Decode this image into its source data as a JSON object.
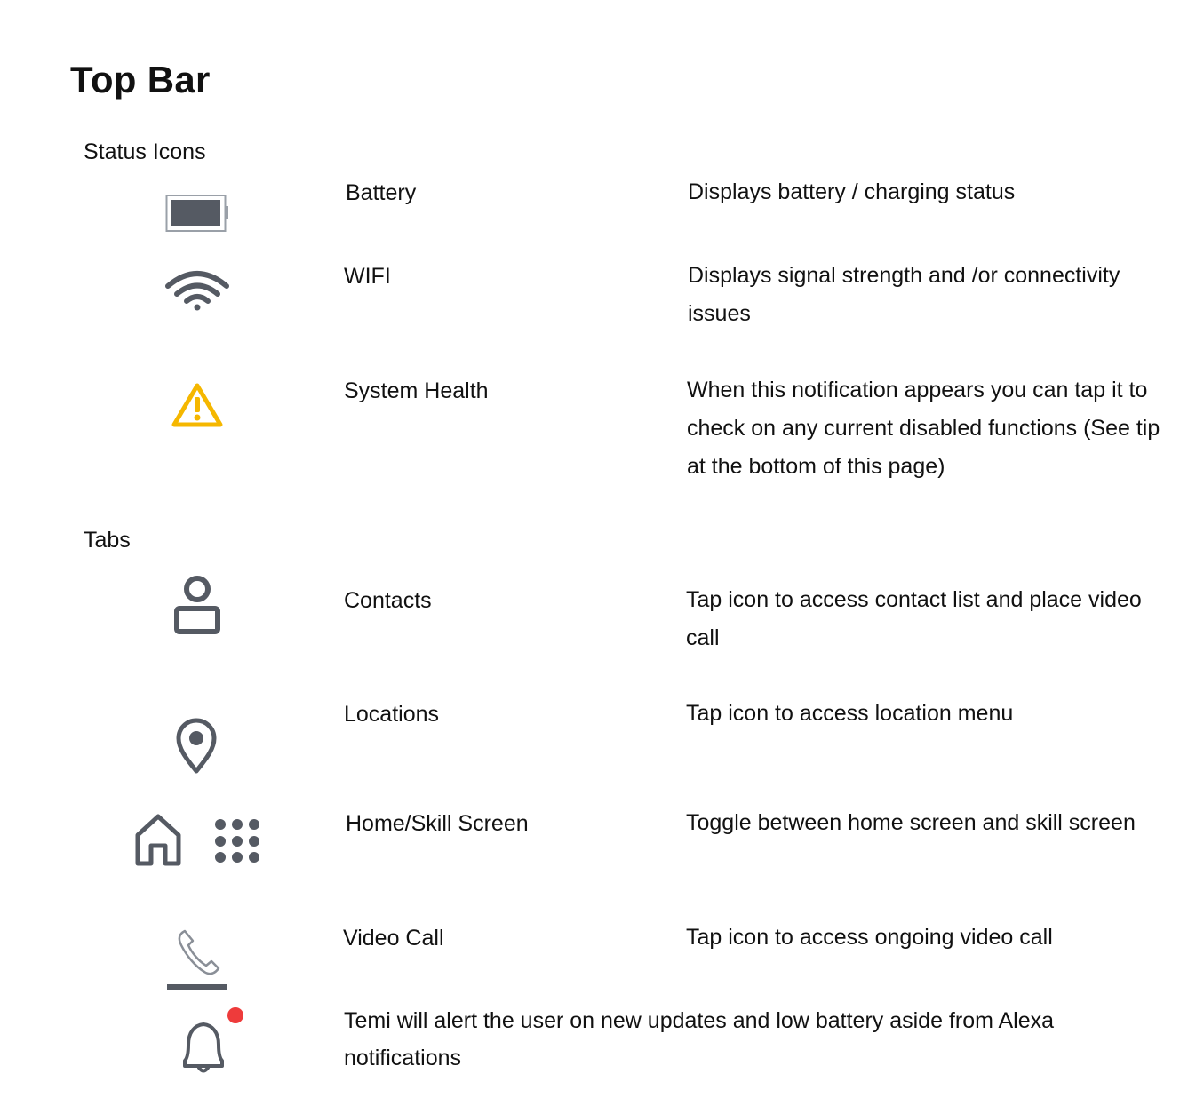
{
  "title": "Top Bar",
  "sections": {
    "status_icons": "Status Icons",
    "tabs": "Tabs"
  },
  "status_items": [
    {
      "icon": "battery-icon",
      "name": "Battery",
      "description": "Displays battery / charging status"
    },
    {
      "icon": "wifi-icon",
      "name": "WIFI",
      "description": "Displays signal strength and /or connectivity issues"
    },
    {
      "icon": "warning-icon",
      "name": "System Health",
      "description": "When this notification appears you can tap it to check on any current disabled functions (See tip at the bottom of this page)"
    }
  ],
  "tab_items": [
    {
      "icon": "contacts-icon",
      "name": "Contacts",
      "description": "Tap icon to access contact list and place video call"
    },
    {
      "icon": "location-pin-icon",
      "name": "Locations",
      "description": "Tap icon to access location menu"
    },
    {
      "icon": "home-icon",
      "icon2": "grid-dots-icon",
      "name": "Home/Skill Screen",
      "description": "Toggle between home screen and skill screen"
    },
    {
      "icon": "phone-icon",
      "name": "Video Call",
      "description": "Tap icon to access ongoing video call"
    }
  ],
  "notification": {
    "icon": "bell-icon",
    "text": "Temi will alert the user on new updates and low battery aside from Alexa notifications"
  },
  "colors": {
    "icon_gray": "#555a63",
    "warning": "#f5b700",
    "alert_dot": "#ee3b3b"
  }
}
